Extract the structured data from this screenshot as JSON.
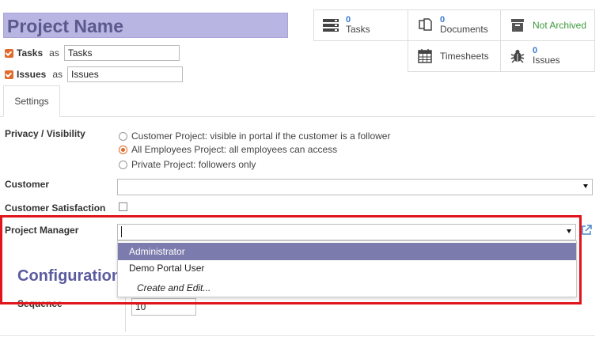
{
  "header": {
    "project_name": "Project Name",
    "aliases": [
      {
        "name": "Tasks",
        "as": "as",
        "value": "Tasks",
        "checked": true
      },
      {
        "name": "Issues",
        "as": "as",
        "value": "Issues",
        "checked": true
      }
    ]
  },
  "stat_buttons": {
    "tasks": {
      "count": "0",
      "label": "Tasks",
      "icon": "tasks-list-icon"
    },
    "documents": {
      "count": "0",
      "label": "Documents",
      "icon": "documents-icon"
    },
    "archive": {
      "label": "Not Archived",
      "icon": "archive-box-icon",
      "color": "#3c9a3c"
    },
    "timesheets": {
      "label": "Timesheets",
      "icon": "calendar-icon"
    },
    "issues": {
      "count": "0",
      "label": "Issues",
      "icon": "bug-icon"
    }
  },
  "tabs": [
    {
      "label": "Settings",
      "active": true
    }
  ],
  "settings": {
    "privacy_label": "Privacy / Visibility",
    "privacy_options": [
      {
        "label": "Customer Project: visible in portal if the customer is a follower",
        "selected": false
      },
      {
        "label": "All Employees Project: all employees can access",
        "selected": true
      },
      {
        "label": "Private Project: followers only",
        "selected": false
      }
    ],
    "customer_label": "Customer",
    "customer_value": "",
    "satisfaction_label": "Customer Satisfaction",
    "satisfaction_checked": false,
    "manager_label": "Project Manager",
    "manager_value": "",
    "manager_dropdown": [
      {
        "label": "Administrator",
        "highlighted": true
      },
      {
        "label": "Demo Portal User",
        "highlighted": false
      },
      {
        "label": "Create and Edit...",
        "highlighted": false
      }
    ]
  },
  "configuration": {
    "title": "Configuration",
    "sequence_label": "Sequence",
    "sequence_value": "10"
  },
  "colors": {
    "title_bg": "#b9b5e3",
    "accent": "#e06a2b",
    "link_blue": "#3a7ad0",
    "dropdown_selected": "#7c7bad",
    "annotation_red": "#e0141b"
  }
}
